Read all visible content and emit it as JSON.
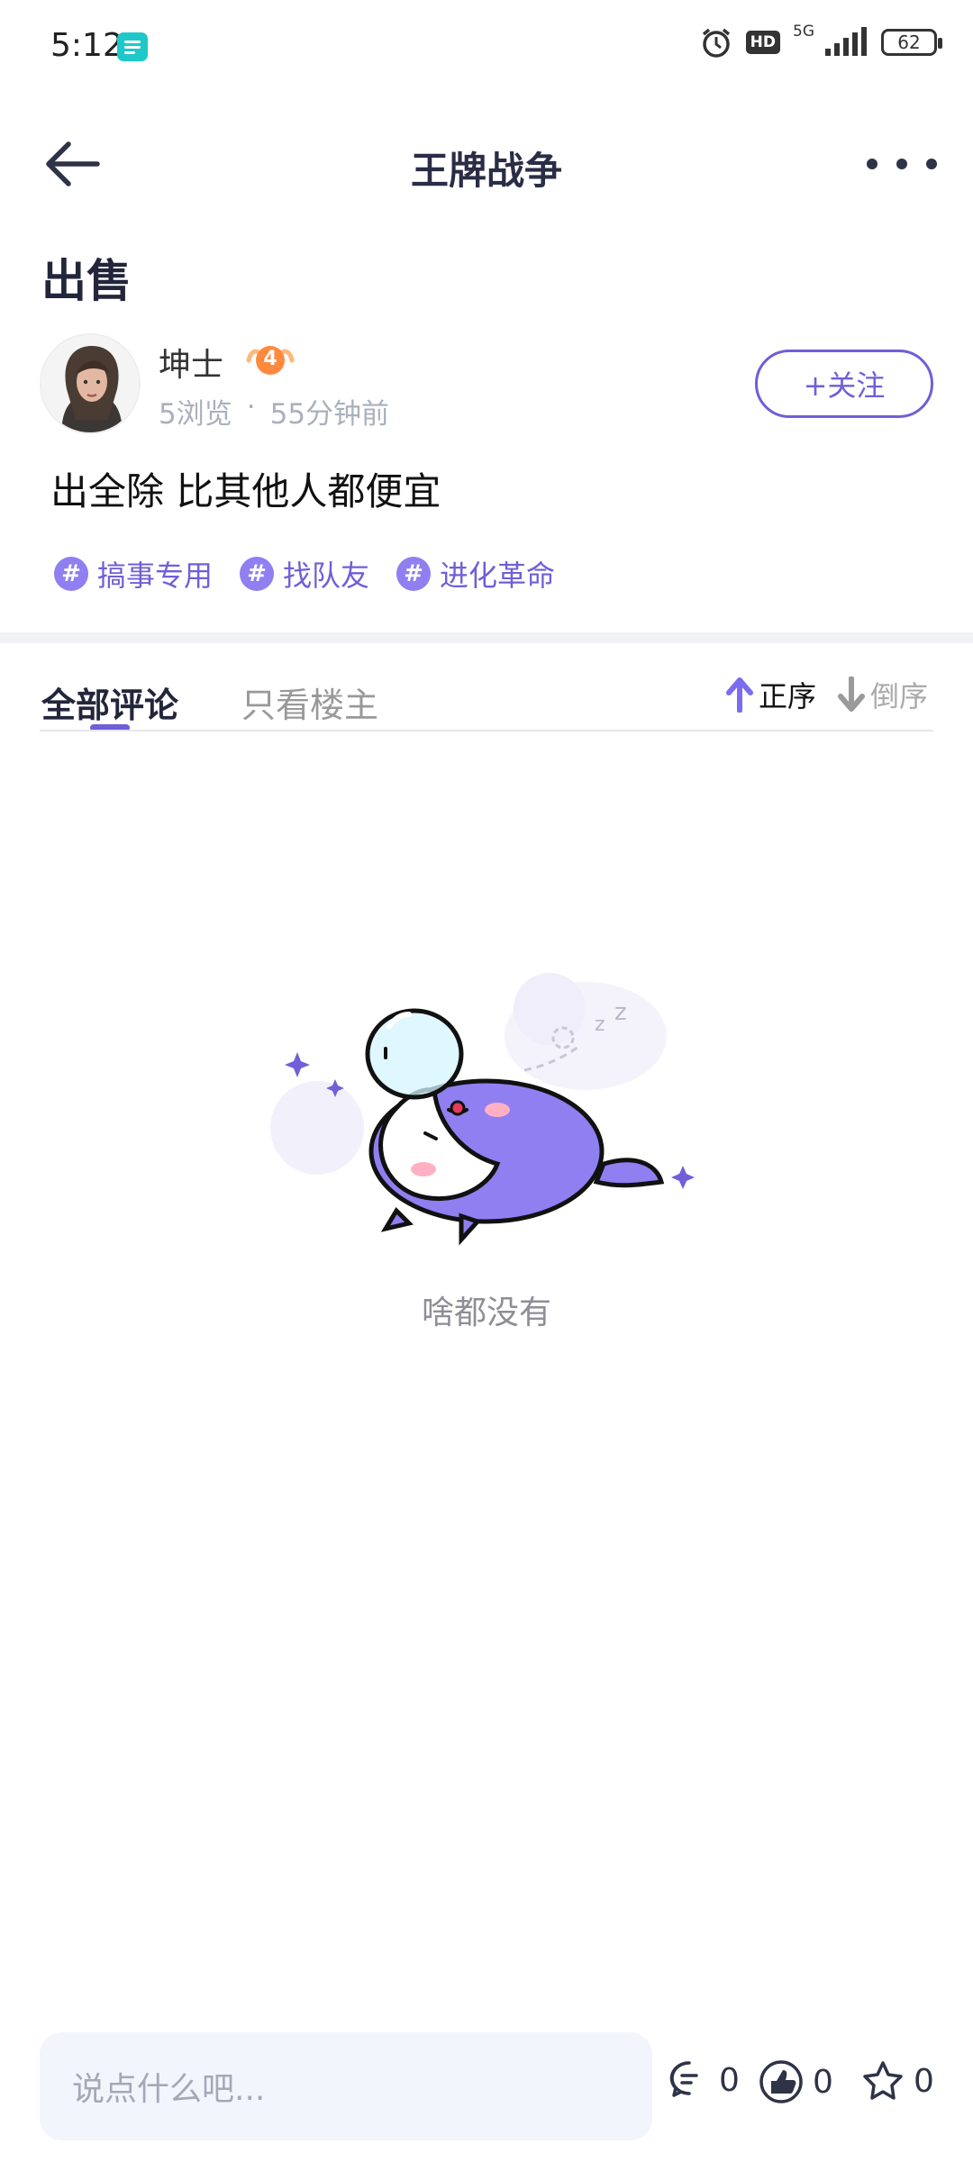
{
  "status_bar": {
    "time": "5:12",
    "hd": "HD",
    "network": "5G",
    "battery": "62"
  },
  "header": {
    "title": "王牌战争"
  },
  "post": {
    "title": "出售",
    "author": "坤士",
    "level": "4",
    "views": "5浏览",
    "separator": "·",
    "time_ago": "55分钟前",
    "follow_label": "+关注",
    "body": "出全除 比其他人都便宜",
    "tags": [
      "搞事专用",
      "找队友",
      "进化革命"
    ],
    "tag_symbol": "#"
  },
  "comments": {
    "tab_all": "全部评论",
    "tab_owner": "只看楼主",
    "sort_asc": "正序",
    "sort_desc": "倒序",
    "empty_text": "啥都没有"
  },
  "bottom_bar": {
    "placeholder": "说点什么吧...",
    "comment_count": "0",
    "like_count": "0",
    "favorite_count": "0"
  },
  "colors": {
    "accent": "#6f5fd8",
    "tag": "#8f7ff0",
    "badge": "#ff8a3d",
    "input_bg": "#f3f5fd"
  }
}
